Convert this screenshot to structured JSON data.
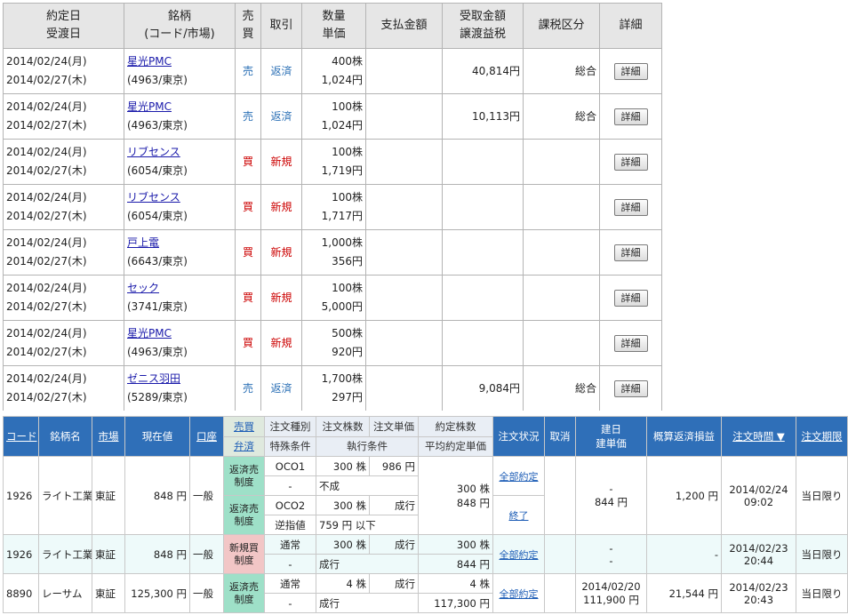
{
  "top_table": {
    "headers": [
      {
        "l1": "約定日",
        "l2": "受渡日"
      },
      {
        "l1": "銘柄",
        "l2": "(コード/市場)"
      },
      {
        "l1": "売",
        "l2": "買"
      },
      {
        "l1": "取引",
        "l2": ""
      },
      {
        "l1": "数量",
        "l2": "単価"
      },
      {
        "l1": "支払金額",
        "l2": ""
      },
      {
        "l1": "受取金額",
        "l2": "譲渡益税"
      },
      {
        "l1": "課税区分",
        "l2": ""
      },
      {
        "l1": "詳細",
        "l2": ""
      }
    ],
    "rows": [
      {
        "date1": "2014/02/24(月)",
        "date2": "2014/02/27(木)",
        "name": "星光PMC",
        "code": "(4963/東京)",
        "side": "売",
        "trade": "返済",
        "qty": "400株",
        "price": "1,024円",
        "pay": "",
        "recv": "40,814円",
        "tax": "",
        "taxcls": "総合",
        "btn": "詳細"
      },
      {
        "date1": "2014/02/24(月)",
        "date2": "2014/02/27(木)",
        "name": "星光PMC",
        "code": "(4963/東京)",
        "side": "売",
        "trade": "返済",
        "qty": "100株",
        "price": "1,024円",
        "pay": "",
        "recv": "10,113円",
        "tax": "",
        "taxcls": "総合",
        "btn": "詳細"
      },
      {
        "date1": "2014/02/24(月)",
        "date2": "2014/02/27(木)",
        "name": "リブセンス",
        "code": "(6054/東京)",
        "side": "買",
        "trade": "新規",
        "qty": "100株",
        "price": "1,719円",
        "pay": "",
        "recv": "",
        "tax": "",
        "taxcls": "",
        "btn": "詳細"
      },
      {
        "date1": "2014/02/24(月)",
        "date2": "2014/02/27(木)",
        "name": "リブセンス",
        "code": "(6054/東京)",
        "side": "買",
        "trade": "新規",
        "qty": "100株",
        "price": "1,717円",
        "pay": "",
        "recv": "",
        "tax": "",
        "taxcls": "",
        "btn": "詳細"
      },
      {
        "date1": "2014/02/24(月)",
        "date2": "2014/02/27(木)",
        "name": "戸上電",
        "code": "(6643/東京)",
        "side": "買",
        "trade": "新規",
        "qty": "1,000株",
        "price": "356円",
        "pay": "",
        "recv": "",
        "tax": "",
        "taxcls": "",
        "btn": "詳細"
      },
      {
        "date1": "2014/02/24(月)",
        "date2": "2014/02/27(木)",
        "name": "セック",
        "code": "(3741/東京)",
        "side": "買",
        "trade": "新規",
        "qty": "100株",
        "price": "5,000円",
        "pay": "",
        "recv": "",
        "tax": "",
        "taxcls": "",
        "btn": "詳細"
      },
      {
        "date1": "2014/02/24(月)",
        "date2": "2014/02/27(木)",
        "name": "星光PMC",
        "code": "(4963/東京)",
        "side": "買",
        "trade": "新規",
        "qty": "500株",
        "price": "920円",
        "pay": "",
        "recv": "",
        "tax": "",
        "taxcls": "",
        "btn": "詳細"
      },
      {
        "date1": "2014/02/24(月)",
        "date2": "2014/02/27(木)",
        "name": "ゼニス羽田",
        "code": "(5289/東京)",
        "side": "売",
        "trade": "返済",
        "qty": "1,700株",
        "price": "297円",
        "pay": "",
        "recv": "9,084円",
        "tax": "",
        "taxcls": "総合",
        "btn": "詳細"
      },
      {
        "date1": "",
        "date2": "",
        "name": "",
        "code": "",
        "side": "",
        "trade": "",
        "qty": "",
        "price": "",
        "pay": "",
        "recv": "",
        "tax": "",
        "taxcls": "",
        "btn": ""
      }
    ]
  },
  "bottom_table": {
    "headers": {
      "code": "コード",
      "name": "銘柄名",
      "market": "市場",
      "price": "現在値",
      "account": "口座",
      "side1": "売買",
      "side2": "弁済",
      "order_type": "注文種別",
      "special": "特殊条件",
      "order_qty": "注文株数",
      "order_price": "注文単価",
      "exec_cond": "執行条件",
      "filled_qty": "約定株数",
      "avg_price": "平均約定単価",
      "status": "注文状況",
      "cancel": "取消",
      "open1": "建日",
      "open2": "建単価",
      "pl": "概算返済損益",
      "time": "注文時間 ▼",
      "expiry": "注文期限"
    },
    "r1": {
      "code": "1926",
      "name": "ライト工業",
      "market": "東証",
      "price": "848 円",
      "account": "一般",
      "side_a": "返済売",
      "side_a2": "制度",
      "side_b": "返済売",
      "side_b2": "制度",
      "a_type": "OCO1",
      "a_qty": "300 株",
      "a_price": "986 円",
      "a_special": "-",
      "a_cond": "不成",
      "b_type": "OCO2",
      "b_qty": "300 株",
      "b_price": "成行",
      "b_special": "逆指値",
      "b_cond": "759 円 以下",
      "filled": "300 株",
      "avg": "848 円",
      "status1": "全部約定",
      "status2": "終了",
      "open1": "-",
      "open2": "844 円",
      "pl": "1,200 円",
      "time1": "2014/02/24",
      "time2": "09:02",
      "expiry": "当日限り"
    },
    "r2": {
      "code": "1926",
      "name": "ライト工業",
      "market": "東証",
      "price": "848 円",
      "account": "一般",
      "side1": "新規買",
      "side2": "制度",
      "type": "通常",
      "qty": "300 株",
      "oprice": "成行",
      "special": "-",
      "cond": "成行",
      "filled": "300 株",
      "avg": "844 円",
      "status": "全部約定",
      "open1": "-",
      "open2": "-",
      "pl": "-",
      "time1": "2014/02/23",
      "time2": "20:44",
      "expiry": "当日限り"
    },
    "r3": {
      "code": "8890",
      "name": "レーサム",
      "market": "東証",
      "price": "125,300 円",
      "account": "一般",
      "side1": "返済売",
      "side2": "制度",
      "type": "通常",
      "qty": "4 株",
      "oprice": "成行",
      "special": "-",
      "cond": "成行",
      "filled": "4 株",
      "avg": "117,300 円",
      "status": "全部約定",
      "open1": "2014/02/20",
      "open2": "111,900 円",
      "pl": "21,544 円",
      "time1": "2014/02/23",
      "time2": "20:43",
      "expiry": "当日限り"
    }
  }
}
